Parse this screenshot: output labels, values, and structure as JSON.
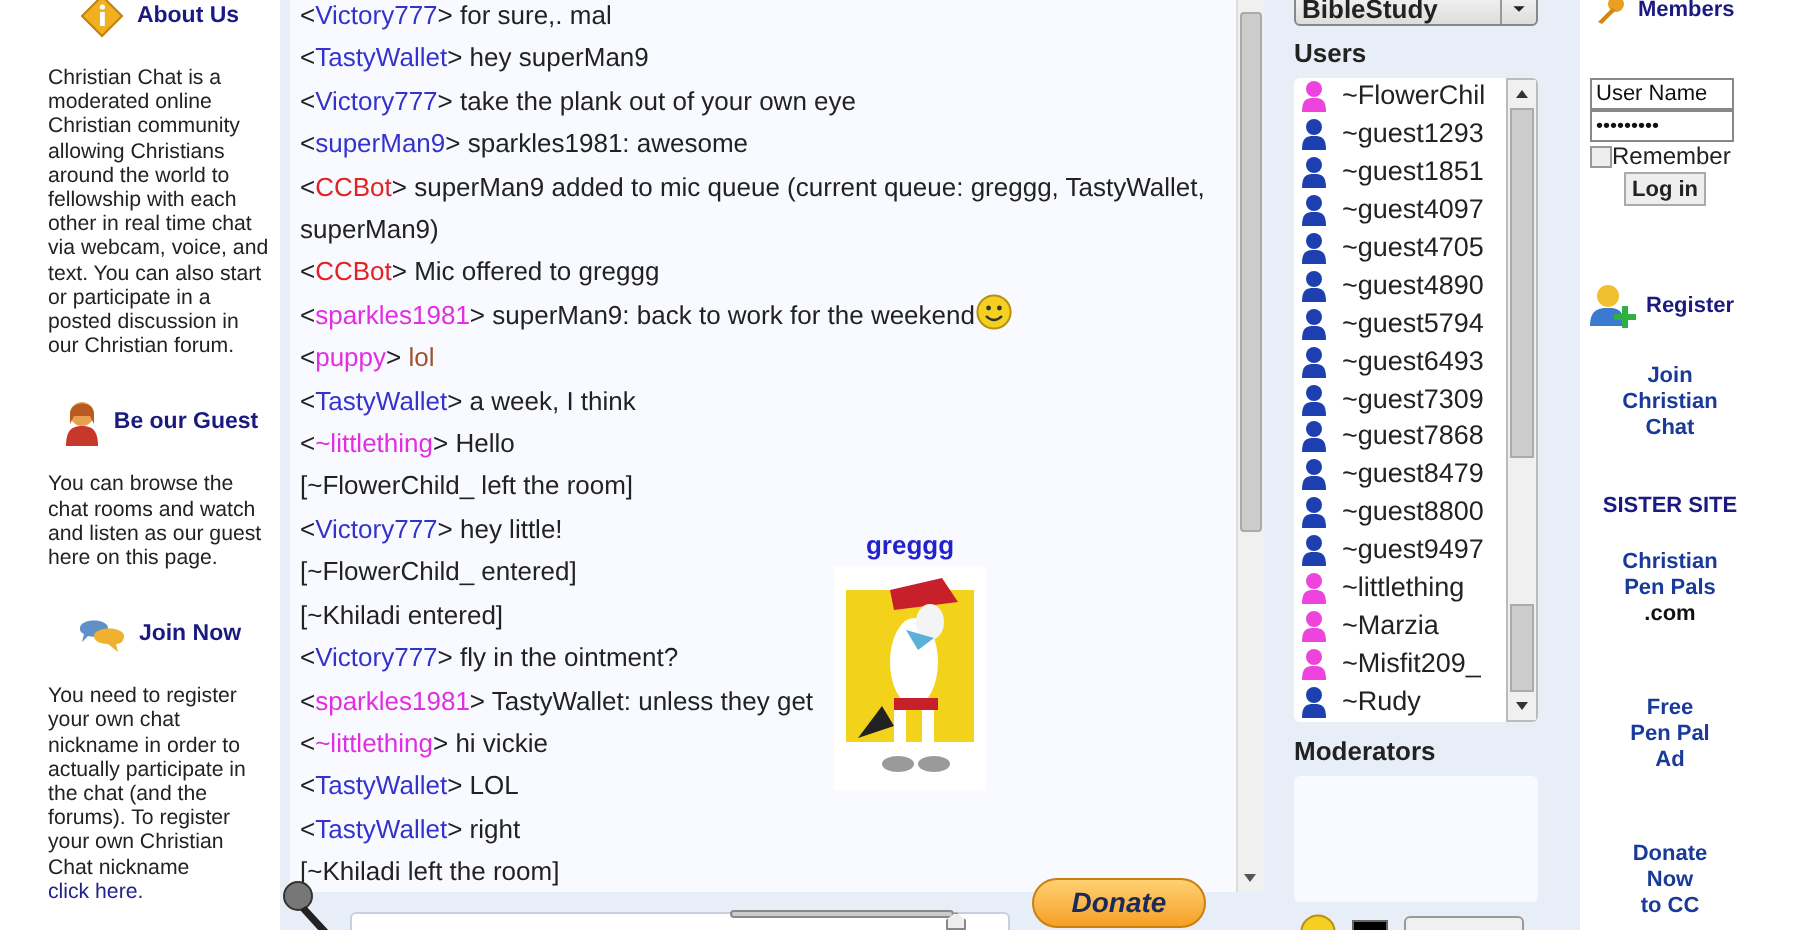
{
  "left_sidebar": {
    "sections": [
      {
        "kind": "info",
        "title": "About Us",
        "text": "Christian Chat is a moderated online Christian community allowing Christians around the world to fellowship with each other in real time chat via webcam, voice, and text. You can also start or participate in a posted discussion in our Christian forum."
      },
      {
        "kind": "guest",
        "title": "Be our Guest",
        "text": "You can browse the chat rooms and watch and listen as our guest here on this page."
      },
      {
        "kind": "join",
        "title": "Join Now",
        "text": "You need to register your own chat nickname in order to actually participate in the chat (and the forums). To register your own Christian Chat nickname",
        "link": "click here."
      }
    ]
  },
  "chat": {
    "messages": [
      {
        "kind": "message",
        "open": "<",
        "nick": "Victory777",
        "color": "#3333cc",
        "text": "> for sure,. mal"
      },
      {
        "kind": "message",
        "open": "<",
        "nick": "TastyWallet",
        "color": "#3333cc",
        "text": "> hey superMan9"
      },
      {
        "kind": "message",
        "open": "<",
        "nick": "Victory777",
        "color": "#3333cc",
        "text": "> take the plank out of your own eye"
      },
      {
        "kind": "message",
        "open": "<",
        "nick": "superMan9",
        "color": "#3333cc",
        "text": "> sparkles1981: awesome"
      },
      {
        "kind": "message",
        "open": "<",
        "nick": "CCBot",
        "color": "#e52222",
        "text": "> superMan9 added to mic queue (current queue: greggg, TastyWallet, superMan9)"
      },
      {
        "kind": "message",
        "open": "<",
        "nick": "CCBot",
        "color": "#e52222",
        "text": "> Mic offered to greggg"
      },
      {
        "kind": "smiley_message",
        "open": "<",
        "nick": "sparkles1981",
        "color": "#e02ee0",
        "text": "> superMan9: back to work for the weekend"
      },
      {
        "kind": "message",
        "open": "<",
        "nick": "puppy",
        "color": "#e02ee0",
        "text": "> ",
        "styled": {
          "text": "lol",
          "color": "#a0522d"
        }
      },
      {
        "kind": "message",
        "open": "<",
        "nick": "TastyWallet",
        "color": "#3333cc",
        "text": "> a week, I think"
      },
      {
        "kind": "message",
        "open": "<",
        "nick": "~littlething",
        "color": "#e02ee0",
        "text": "> Hello"
      },
      {
        "kind": "event",
        "text": "[~FlowerChild_ left the room]"
      },
      {
        "kind": "message",
        "open": "<",
        "nick": "Victory777",
        "color": "#3333cc",
        "text": "> hey little!"
      },
      {
        "kind": "event",
        "text": "[~FlowerChild_ entered]"
      },
      {
        "kind": "event",
        "text": "[~Khiladi entered]"
      },
      {
        "kind": "message",
        "open": "<",
        "nick": "Victory777",
        "color": "#3333cc",
        "text": "> fly in the ointment?"
      },
      {
        "kind": "message",
        "open": "<",
        "nick": "sparkles1981",
        "color": "#e02ee0",
        "text": "> TastyWallet: unless they get"
      },
      {
        "kind": "message",
        "open": "<",
        "nick": "~littlething",
        "color": "#e02ee0",
        "text": "> hi vickie"
      },
      {
        "kind": "message",
        "open": "<",
        "nick": "TastyWallet",
        "color": "#3333cc",
        "text": "> LOL"
      },
      {
        "kind": "message",
        "open": "<",
        "nick": "TastyWallet",
        "color": "#3333cc",
        "text": "> right"
      },
      {
        "kind": "event",
        "text": "[~Khiladi left the room]"
      }
    ],
    "webcam": {
      "name": "greggg",
      "kind": "picture"
    },
    "volume": {
      "level": 1
    },
    "donate_button": "Donate"
  },
  "room_select": {
    "value": "BibleStudy"
  },
  "users": {
    "title": "Users",
    "items": [
      {
        "name": "~FlowerChil",
        "kind": "female"
      },
      {
        "name": "~guest1293",
        "kind": "male"
      },
      {
        "name": "~guest1851",
        "kind": "male"
      },
      {
        "name": "~guest4097",
        "kind": "male"
      },
      {
        "name": "~guest4705",
        "kind": "male"
      },
      {
        "name": "~guest4890",
        "kind": "male"
      },
      {
        "name": "~guest5794",
        "kind": "male"
      },
      {
        "name": "~guest6493",
        "kind": "male"
      },
      {
        "name": "~guest7309",
        "kind": "male"
      },
      {
        "name": "~guest7868",
        "kind": "male"
      },
      {
        "name": "~guest8479",
        "kind": "male"
      },
      {
        "name": "~guest8800",
        "kind": "male"
      },
      {
        "name": "~guest9497",
        "kind": "male"
      },
      {
        "name": "~littlething",
        "kind": "female"
      },
      {
        "name": "~Marzia",
        "kind": "female"
      },
      {
        "name": "~Misfit209_",
        "kind": "female"
      },
      {
        "name": "~Rudy",
        "kind": "male"
      }
    ]
  },
  "moderators": {
    "title": "Moderators"
  },
  "right_sidebar": {
    "members_title": "Members",
    "username": "User Name",
    "password": "•••••••••",
    "remember": {
      "label": "Remember",
      "checked": false
    },
    "login_button": "Log in",
    "register_title": "Register",
    "links": [
      {
        "kind": "link",
        "text": "Join\nChristian\nChat"
      },
      {
        "kind": "heading",
        "text": "SISTER SITE"
      },
      {
        "kind": "link",
        "text": "Christian\nPen Pals",
        "suffix": ".com"
      },
      {
        "kind": "link",
        "text": "Free\nPen Pal\nAd"
      },
      {
        "kind": "link",
        "text": "Donate\nNow\nto CC"
      }
    ]
  }
}
